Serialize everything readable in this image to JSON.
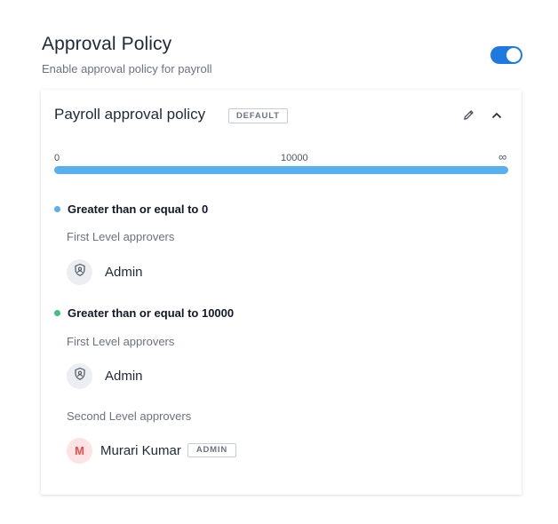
{
  "header": {
    "title": "Approval Policy",
    "subtitle": "Enable approval policy for payroll",
    "toggle_on": true,
    "toggle_color": "#1f7ae0"
  },
  "policy": {
    "name": "Payroll approval policy",
    "badge": "DEFAULT",
    "edit_icon": "pencil-icon",
    "collapse_icon": "chevron-up-icon",
    "range": {
      "start": "0",
      "mid": "10000",
      "end": "∞",
      "bar_color": "#58b0ee"
    },
    "tiers": [
      {
        "condition": "Greater than or equal to 0",
        "dot_color": "#58b0ee",
        "levels": [
          {
            "label": "First Level approvers",
            "approvers": [
              {
                "name": "Admin",
                "icon": "role-shield-icon"
              }
            ]
          }
        ]
      },
      {
        "condition": "Greater than or equal to 10000",
        "dot_color": "#3cc47c",
        "levels": [
          {
            "label": "First Level approvers",
            "approvers": [
              {
                "name": "Admin",
                "icon": "role-shield-icon"
              }
            ]
          },
          {
            "label": "Second Level approvers",
            "approvers": [
              {
                "name": "Murari Kumar",
                "initial": "M",
                "badge": "ADMIN"
              }
            ]
          }
        ]
      }
    ]
  }
}
